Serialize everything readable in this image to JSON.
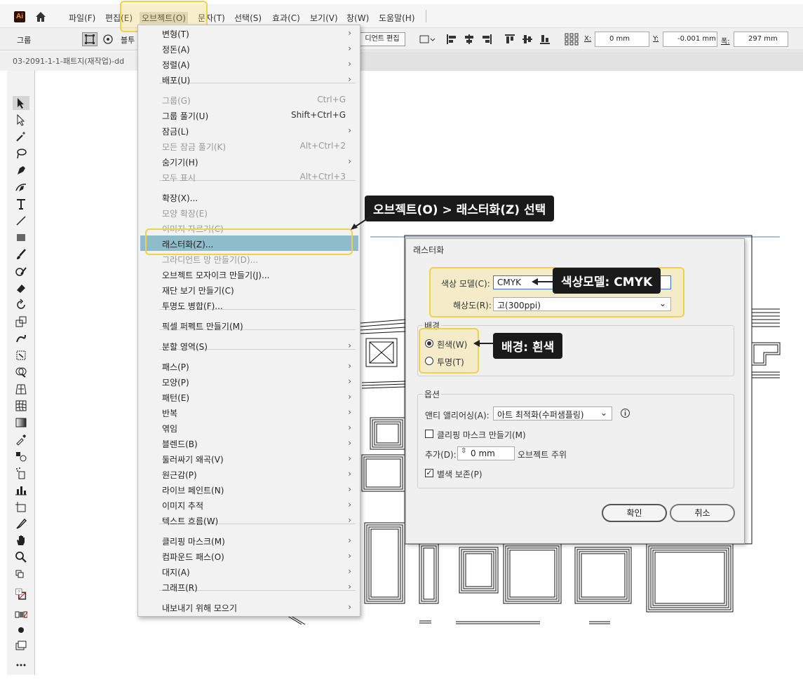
{
  "menubar": {
    "items": [
      "파일(F)",
      "편집(E)",
      "오브젝트(O)",
      "문자(T)",
      "선택(S)",
      "효과(C)",
      "보기(V)",
      "창(W)",
      "도움말(H)"
    ],
    "logo": "Ai"
  },
  "toolbar": {
    "group_label": "그룹",
    "partial_label": "블투",
    "gradient_edit_btn": "디언트 편집",
    "x_label": "X:",
    "x_value": "0 mm",
    "y_label": "Y:",
    "y_value": "-0.001 mm",
    "w_label": "폭:",
    "w_value": "297 mm"
  },
  "tab": {
    "title": "03-2091-1-1-패트지(재작업)-dd"
  },
  "object_menu": {
    "items": [
      {
        "label": "변형(T)",
        "arrow": true
      },
      {
        "label": "정돈(A)",
        "arrow": true
      },
      {
        "label": "정렬(A)",
        "arrow": true
      },
      {
        "label": "배포(U)",
        "arrow": true
      },
      {
        "label": "그룹(G)",
        "shortcut": "Ctrl+G",
        "disabled": true
      },
      {
        "label": "그룹 풀기(U)",
        "shortcut": "Shift+Ctrl+G"
      },
      {
        "label": "잠금(L)",
        "arrow": true
      },
      {
        "label": "모든 잠금 풀기(K)",
        "shortcut": "Alt+Ctrl+2",
        "disabled": true
      },
      {
        "label": "숨기기(H)",
        "arrow": true
      },
      {
        "label": "모두 표시",
        "shortcut": "Alt+Ctrl+3",
        "disabled": true
      },
      {
        "label": "확장(X)..."
      },
      {
        "label": "모양 확장(E)",
        "disabled": true
      },
      {
        "label": "이미지 자르기(C)",
        "disabled": true
      },
      {
        "label": "래스터화(Z)...",
        "highlight": true
      },
      {
        "label": "그라디언트 망 만들기(D)...",
        "disabled": true
      },
      {
        "label": "오브젝트 모자이크 만들기(J)..."
      },
      {
        "label": "재단 보기 만들기(C)"
      },
      {
        "label": "투명도 병합(F)..."
      },
      {
        "label": "픽셀 퍼펙트 만들기(M)"
      },
      {
        "label": "분할 영역(S)",
        "arrow": true
      },
      {
        "label": "패스(P)",
        "arrow": true
      },
      {
        "label": "모양(P)",
        "arrow": true
      },
      {
        "label": "패턴(E)",
        "arrow": true
      },
      {
        "label": "반복",
        "arrow": true
      },
      {
        "label": "엮임",
        "arrow": true
      },
      {
        "label": "블렌드(B)",
        "arrow": true
      },
      {
        "label": "둘러싸기 왜곡(V)",
        "arrow": true
      },
      {
        "label": "원근감(P)",
        "arrow": true
      },
      {
        "label": "라이브 페인트(N)",
        "arrow": true
      },
      {
        "label": "이미지 추적",
        "arrow": true
      },
      {
        "label": "텍스트 흐름(W)",
        "arrow": true
      },
      {
        "label": "클리핑 마스크(M)",
        "arrow": true
      },
      {
        "label": "컴파운드 패스(O)",
        "arrow": true
      },
      {
        "label": "대지(A)",
        "arrow": true
      },
      {
        "label": "그래프(R)",
        "arrow": true
      },
      {
        "label": "내보내기 위해 모으기",
        "arrow": true
      }
    ]
  },
  "callouts": {
    "menu_step": "오브젝트(O) > 래스터화(Z) 선택",
    "color_model": "색상모델: CMYK",
    "background": "배경: 흰색"
  },
  "dialog": {
    "title": "래스터화",
    "color_model_label": "색상 모델(C):",
    "color_model_value": "CMYK",
    "resolution_label": "해상도(R):",
    "resolution_value": "고(300ppi)",
    "background_group": "배경",
    "bg_white": "흰색(W)",
    "bg_transparent": "투명(T)",
    "options_group": "옵션",
    "antialias_label": "앤티 앨리어싱(A):",
    "antialias_value": "아트 최적화(수퍼샘플링)",
    "clip_mask_label": "클리핑 마스크 만들기(M)",
    "add_label": "추가(D):",
    "add_value": "0 mm",
    "add_suffix": "오브젝트 주위",
    "spot_label": "별색 보존(P)",
    "ok": "확인",
    "cancel": "취소"
  }
}
